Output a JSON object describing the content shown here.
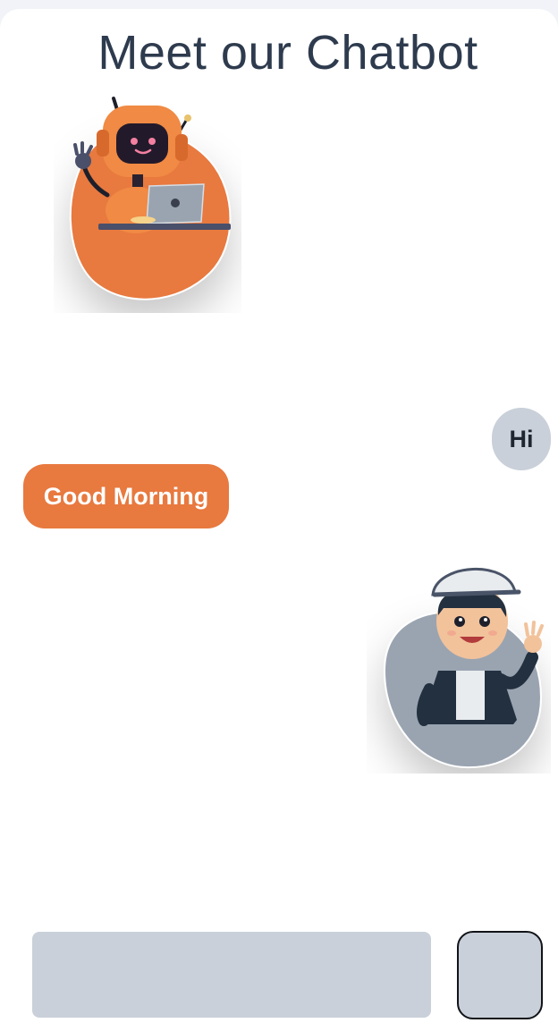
{
  "header": {
    "title": "Meet our Chatbot"
  },
  "avatars": {
    "bot": {
      "icon": "robot-with-laptop-icon",
      "blob_color": "#e8793f"
    },
    "user": {
      "icon": "boy-waving-icon",
      "blob_color": "#9aa4b1"
    }
  },
  "messages": [
    {
      "sender": "user",
      "text": "Hi",
      "bubble_color": "#c9d0d9"
    },
    {
      "sender": "bot",
      "text": "Good Morning",
      "bubble_color": "#e8793f"
    }
  ],
  "composer": {
    "input_value": "",
    "input_placeholder": "",
    "send_icon": "send-icon"
  },
  "colors": {
    "accent": "#e8793f",
    "title": "#2e3b4e",
    "input_bg": "#cad0d9"
  }
}
